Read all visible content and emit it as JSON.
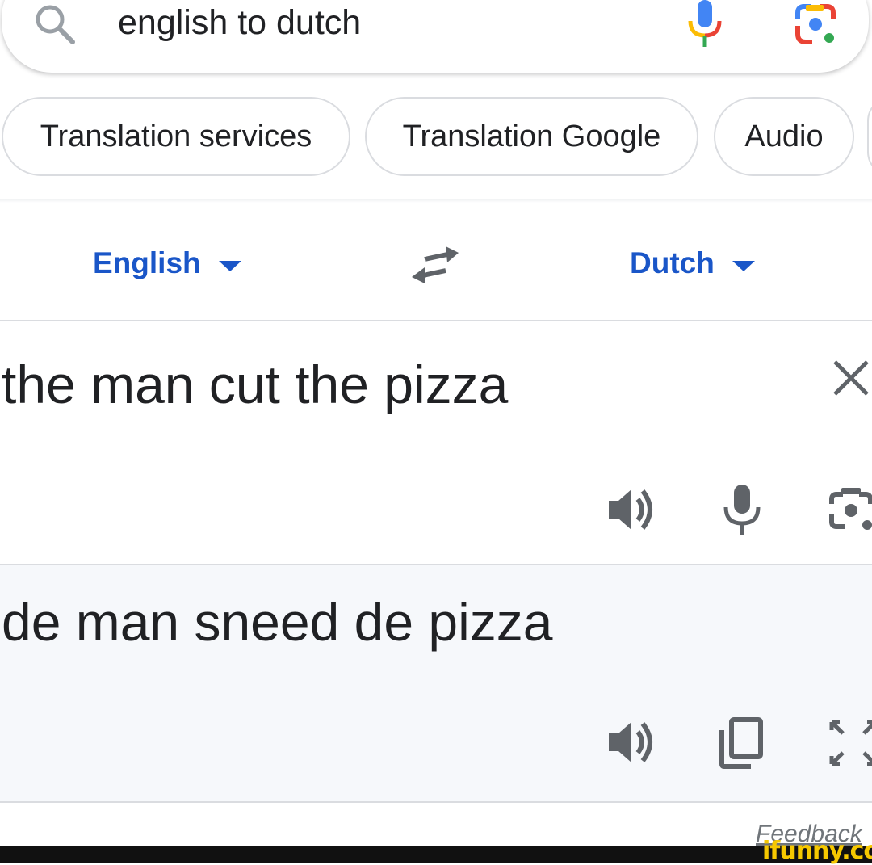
{
  "search": {
    "query": "english to dutch"
  },
  "chips": [
    {
      "label": "Translation services"
    },
    {
      "label": "Translation Google"
    },
    {
      "label": "Audio"
    }
  ],
  "translator": {
    "source_language": "English",
    "target_language": "Dutch",
    "source_text": "the man cut the pizza",
    "translated_text": "de man sneed de pizza"
  },
  "footer": {
    "feedback_label": "Feedback",
    "watermark": "ifunny.co"
  },
  "colors": {
    "language_link": "#1a56c8",
    "google_blue": "#4285F4",
    "google_red": "#EA4335",
    "google_yellow": "#FBBC05",
    "google_green": "#34A853",
    "icon_gray": "#5f6368"
  },
  "icons": [
    "search-icon",
    "mic-icon",
    "lens-icon",
    "swap-icon",
    "clear-icon",
    "speaker-icon",
    "camera-icon",
    "copy-icon",
    "expand-icon"
  ]
}
